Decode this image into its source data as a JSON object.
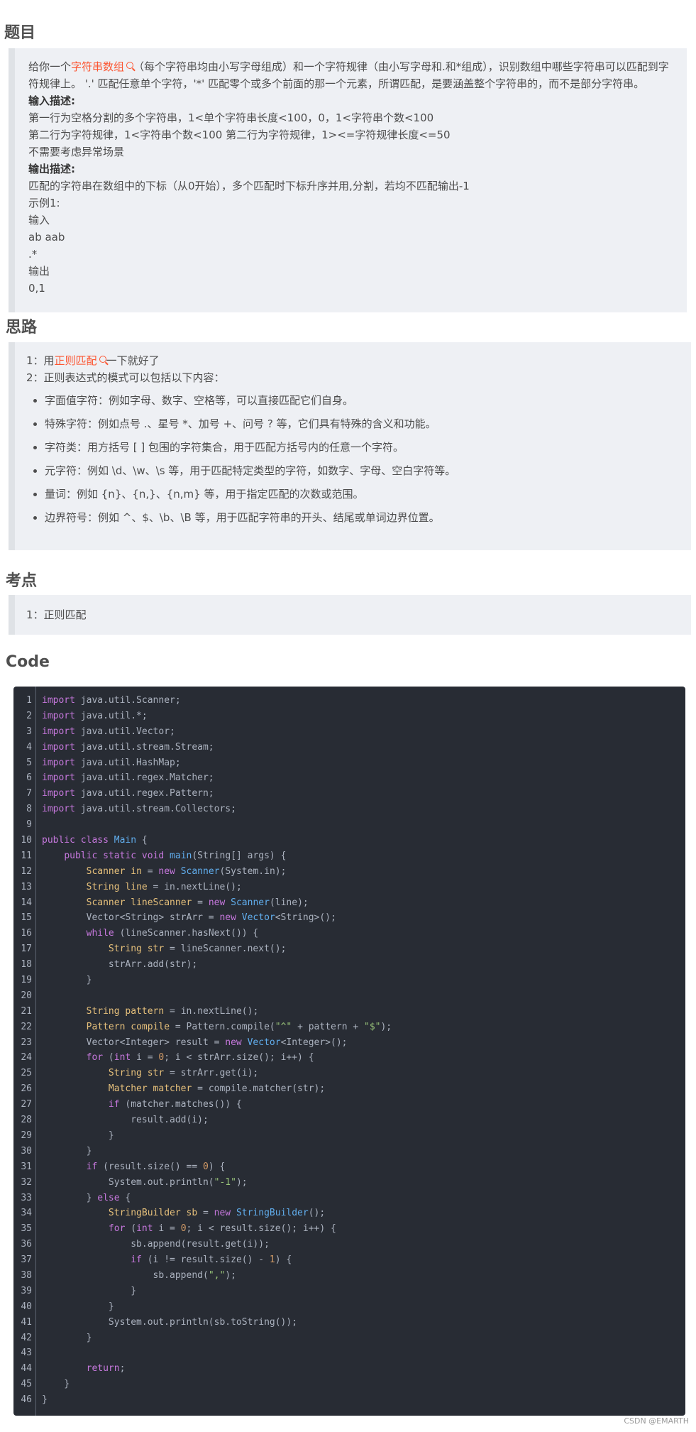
{
  "title_heading": "题目",
  "problem": {
    "desc_prefix": "给你一个",
    "desc_link": "字符串数组",
    "desc_rest": "（每个字符串均由小写字母组成）和一个字符规律（由小写字母和.和*组成），识别数组中哪些字符串可以匹配到字符规律上。 '.' 匹配任意单个字符，'*' 匹配零个或多个前面的那一个元素，所谓匹配，是要涵盖整个字符串的，而不是部分字符串。",
    "input_title": "输入描述:",
    "input_lines": [
      "第一行为空格分割的多个字符串，1<单个字符串长度<100，0，1<字符串个数<100",
      "第二行为字符规律，1<字符串个数<100  第二行为字符规律，1><=字符规律长度<=50",
      "不需要考虑异常场景"
    ],
    "output_title": "输出描述:",
    "output_lines": [
      "匹配的字符串在数组中的下标（从0开始），多个匹配时下标升序并用,分割，若均不匹配输出-1",
      "示例1:",
      "输入",
      "ab aab",
      ".*",
      "输出",
      "0,1"
    ]
  },
  "idea_heading": "思路",
  "idea": {
    "line1_prefix": "1：用",
    "line1_link": "正则匹配",
    "line1_suffix": "一下就好了",
    "line2": "2：正则表达式的模式可以包括以下内容：",
    "bullets": [
      "字面值字符：例如字母、数字、空格等，可以直接匹配它们自身。",
      "特殊字符：例如点号 .、星号 *、加号 +、问号 ? 等，它们具有特殊的含义和功能。",
      "字符类：用方括号 [ ] 包围的字符集合，用于匹配方括号内的任意一个字符。",
      "元字符：例如 \\d、\\w、\\s 等，用于匹配特定类型的字符，如数字、字母、空白字符等。",
      "量词：例如 {n}、{n,}、{n,m} 等，用于指定匹配的次数或范围。",
      "边界符号：例如 ^、$、\\b、\\B 等，用于匹配字符串的开头、结尾或单词边界位置。"
    ]
  },
  "points_heading": "考点",
  "points": {
    "line1": "1：正则匹配"
  },
  "code_heading": "Code",
  "code_lines": [
    "import java.util.Scanner;",
    "import java.util.*;",
    "import java.util.Vector;",
    "import java.util.stream.Stream;",
    "import java.util.HashMap;",
    "import java.util.regex.Matcher;",
    "import java.util.regex.Pattern;",
    "import java.util.stream.Collectors;",
    "",
    "public class Main {",
    "    public static void main(String[] args) {",
    "        Scanner in = new Scanner(System.in);",
    "        String line = in.nextLine();",
    "        Scanner lineScanner = new Scanner(line);",
    "        Vector<String> strArr = new Vector<String>();",
    "        while (lineScanner.hasNext()) {",
    "            String str = lineScanner.next();",
    "            strArr.add(str);",
    "        }",
    "",
    "        String pattern = in.nextLine();",
    "        Pattern compile = Pattern.compile(\"^\" + pattern + \"$\");",
    "        Vector<Integer> result = new Vector<Integer>();",
    "        for (int i = 0; i < strArr.size(); i++) {",
    "            String str = strArr.get(i);",
    "            Matcher matcher = compile.matcher(str);",
    "            if (matcher.matches()) {",
    "                result.add(i);",
    "            }",
    "        }",
    "        if (result.size() == 0) {",
    "            System.out.println(\"-1\");",
    "        } else {",
    "            StringBuilder sb = new StringBuilder();",
    "            for (int i = 0; i < result.size(); i++) {",
    "                sb.append(result.get(i));",
    "                if (i != result.size() - 1) {",
    "                    sb.append(\",\");",
    "                }",
    "            }",
    "            System.out.println(sb.toString());",
    "        }",
    "",
    "        return;",
    "    }",
    "}"
  ],
  "footer": "CSDN @EMARTH"
}
